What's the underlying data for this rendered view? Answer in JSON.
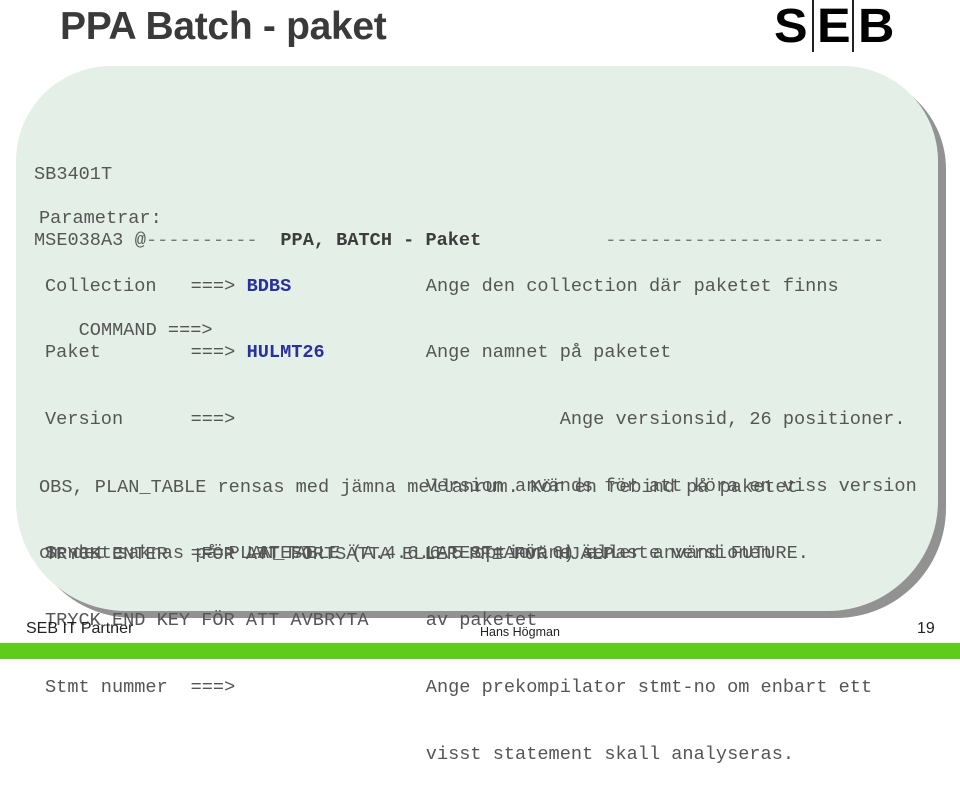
{
  "slide": {
    "title": "PPA Batch - paket",
    "logo": {
      "letters": [
        "S",
        "E",
        "B"
      ]
    }
  },
  "terminal": {
    "screen_id": "SB3401T",
    "header": {
      "panel_id": "MSE038A3",
      "at_sign": "@",
      "left_dashes": "----------",
      "title": "PPA, BATCH - Paket",
      "right_dashes": "-------------------------"
    },
    "command": {
      "label": "COMMAND ===>",
      "value": ""
    },
    "params_heading": "Parametrar:",
    "params": [
      {
        "label": "Collection",
        "arrow": "===>",
        "value": "BDBS",
        "value_style": "highlight",
        "description": [
          "Ange den collection där paketet finns"
        ]
      },
      {
        "label": "Paket",
        "arrow": "===>",
        "value": "HULMT26",
        "value_style": "highlight",
        "description": [
          "Ange namnet på paketet"
        ]
      },
      {
        "label": "Version",
        "arrow": "===>",
        "value": "",
        "value_style": "plain",
        "description": [
          "            Ange versionsid, 26 positioner.",
          "Version används för att köra en viss version"
        ]
      },
      {
        "label": "Senaste",
        "arrow": "===>",
        "value": "LATEST",
        "value_style": "plain",
        "description": [
          "LATEST=Använd senaste versionen",
          "av paketet"
        ]
      },
      {
        "label": "Stmt nummer",
        "arrow": "===>",
        "value": "",
        "value_style": "plain",
        "description": [
          "Ange prekompilator stmt-no om enbart ett",
          "visst statement skall analyseras."
        ]
      }
    ],
    "note_lines": [
      "OBS, PLAN_TABLE rensas med jämna mellanrum. Kör en rebind på paketet",
      "om det saknas på PLAN_TABLE (A.4.6.6.5 option 6) eller använd FUTURE."
    ],
    "instructions": [
      "TRYCK ENTER   FÖR ATT FORTSÄTTA ELLER PF1 FÖR HJÄLP",
      "TRYCK END KEY FÖR ATT AVBRYTA"
    ]
  },
  "footer": {
    "left": "SEB IT Partner",
    "center": "Hans Högman",
    "page_number": "19"
  },
  "colors": {
    "panel_bg": "#e4efe8",
    "panel_shadow": "#929292",
    "value_highlight": "#28329a",
    "green_bar": "#5fcb1a",
    "terminal_text": "#555555"
  }
}
